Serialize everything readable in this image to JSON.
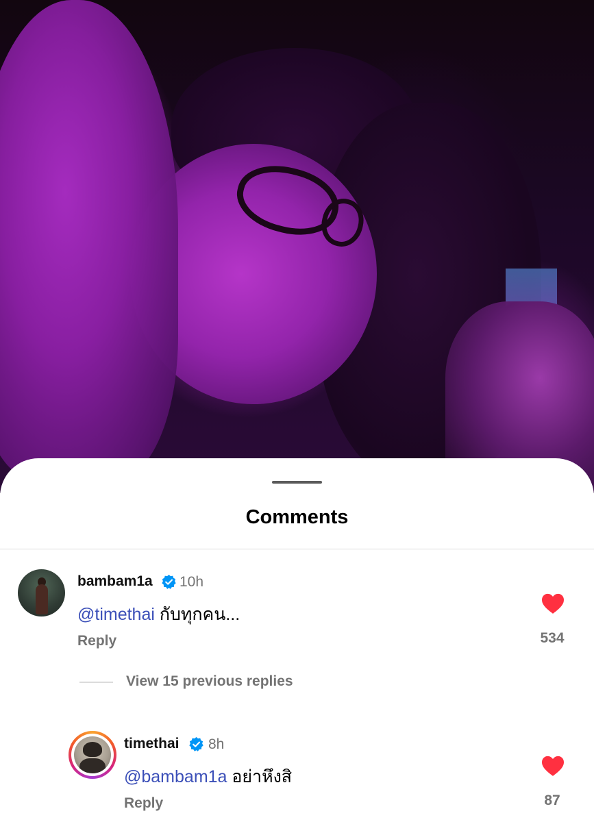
{
  "sheet": {
    "title": "Comments"
  },
  "comments": [
    {
      "username": "bambam1a",
      "verified": true,
      "time": "10h",
      "mention": "@timethai",
      "text": " กับทุกคน...",
      "reply_label": "Reply",
      "likes": "534",
      "liked": true
    }
  ],
  "view_replies": {
    "label": "View 15 previous replies"
  },
  "replies": [
    {
      "username": "timethai",
      "verified": true,
      "time": "8h",
      "mention": "@bambam1a",
      "text": " อย่าหึงสิ",
      "reply_label": "Reply",
      "likes": "87",
      "liked": true,
      "has_story_ring": true
    }
  ],
  "colors": {
    "mention": "#3b4fb8",
    "heart": "#ff3040",
    "verified": "#0095f6",
    "muted_text": "#737373"
  },
  "icons": {
    "verified": "verified-badge-icon",
    "heart": "heart-filled-icon"
  }
}
